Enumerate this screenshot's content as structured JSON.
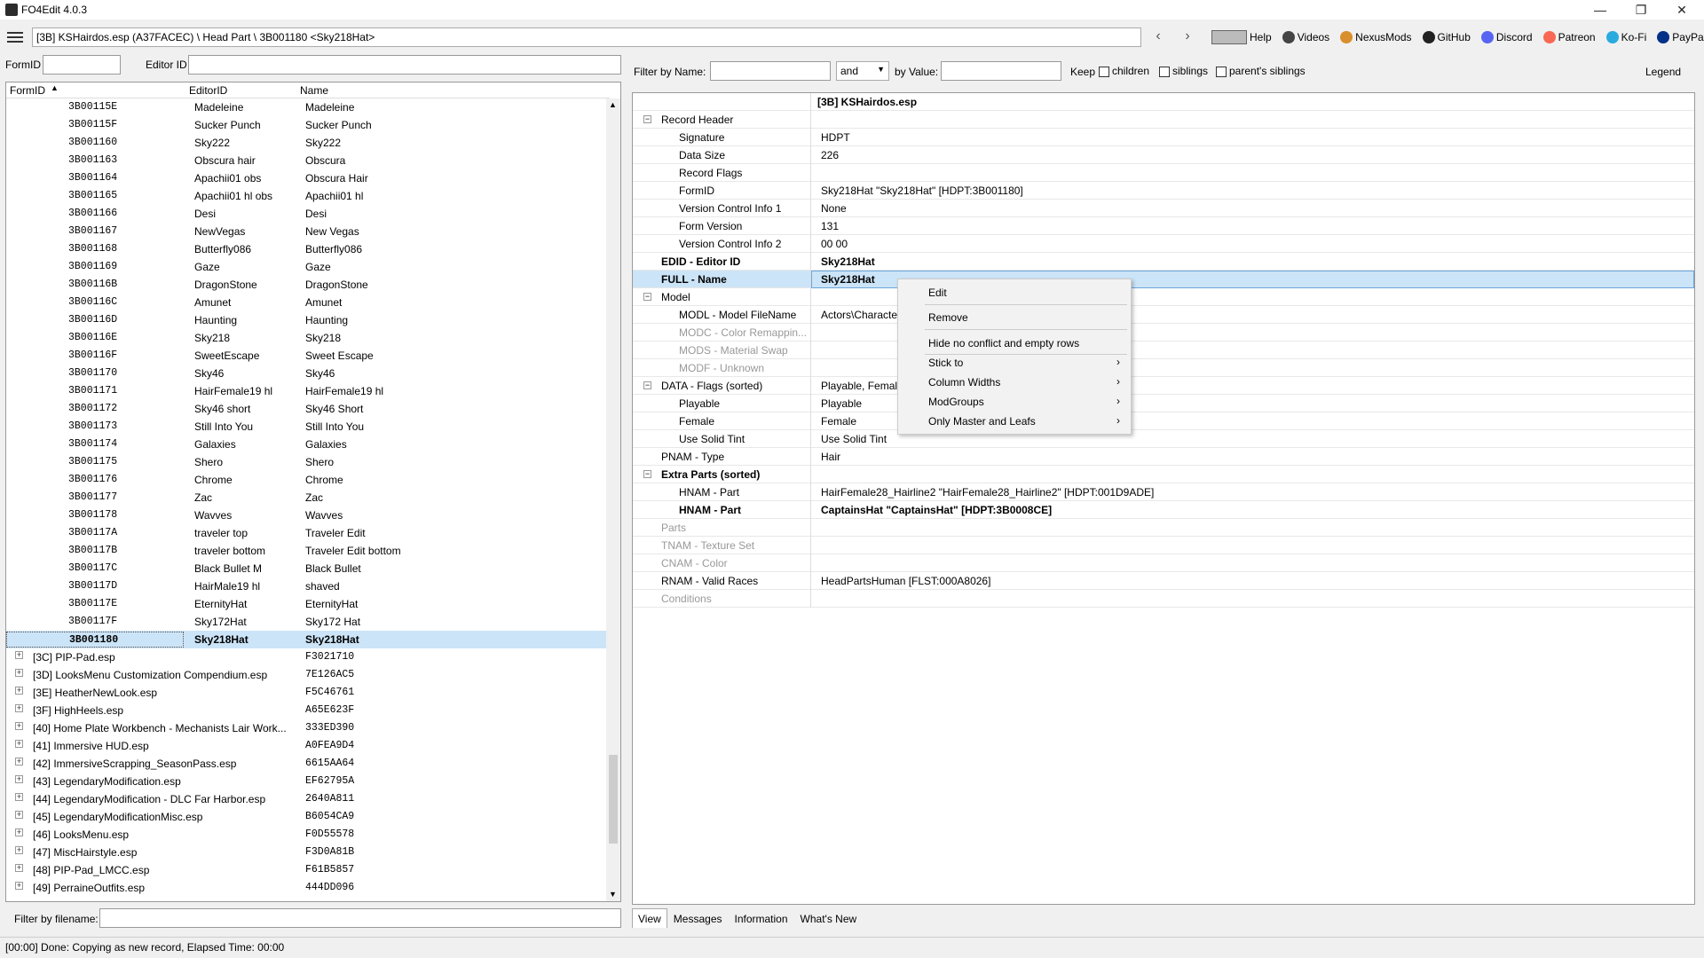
{
  "window": {
    "title": "FO4Edit 4.0.3"
  },
  "toolbar": {
    "path": "[3B] KSHairdos.esp (A37FACEC) \\ Head Part \\ 3B001180 <Sky218Hat>",
    "back": "‹",
    "forward": "›",
    "links": [
      "Help",
      "Videos",
      "NexusMods",
      "GitHub",
      "Discord",
      "Patreon",
      "Ko-Fi",
      "PayPal"
    ]
  },
  "left": {
    "formid_label": "FormID",
    "editorid_label": "Editor ID",
    "columns": [
      "FormID",
      "EditorID",
      "Name"
    ],
    "records": [
      [
        "3B00115E",
        "Madeleine",
        "Madeleine"
      ],
      [
        "3B00115F",
        "Sucker Punch",
        "Sucker Punch"
      ],
      [
        "3B001160",
        "Sky222",
        "Sky222"
      ],
      [
        "3B001163",
        "Obscura hair",
        "Obscura"
      ],
      [
        "3B001164",
        "Apachii01 obs",
        "Obscura Hair"
      ],
      [
        "3B001165",
        "Apachii01 hl obs",
        "Apachii01 hl"
      ],
      [
        "3B001166",
        "Desi",
        "Desi"
      ],
      [
        "3B001167",
        "NewVegas",
        "New Vegas"
      ],
      [
        "3B001168",
        "Butterfly086",
        "Butterfly086"
      ],
      [
        "3B001169",
        "Gaze",
        "Gaze"
      ],
      [
        "3B00116B",
        "DragonStone",
        "DragonStone"
      ],
      [
        "3B00116C",
        "Amunet",
        "Amunet"
      ],
      [
        "3B00116D",
        "Haunting",
        "Haunting"
      ],
      [
        "3B00116E",
        "Sky218",
        "Sky218"
      ],
      [
        "3B00116F",
        "SweetEscape",
        "Sweet Escape"
      ],
      [
        "3B001170",
        "Sky46",
        "Sky46"
      ],
      [
        "3B001171",
        "HairFemale19 hl",
        "HairFemale19 hl"
      ],
      [
        "3B001172",
        "Sky46 short",
        "Sky46 Short"
      ],
      [
        "3B001173",
        "Still Into You",
        "Still Into You"
      ],
      [
        "3B001174",
        "Galaxies",
        "Galaxies"
      ],
      [
        "3B001175",
        "Shero",
        "Shero"
      ],
      [
        "3B001176",
        "Chrome",
        "Chrome"
      ],
      [
        "3B001177",
        "Zac",
        "Zac"
      ],
      [
        "3B001178",
        "Wavves",
        "Wavves"
      ],
      [
        "3B00117A",
        "traveler top",
        "Traveler Edit"
      ],
      [
        "3B00117B",
        "traveler bottom",
        "Traveler Edit bottom"
      ],
      [
        "3B00117C",
        "Black Bullet M",
        "Black Bullet"
      ],
      [
        "3B00117D",
        "HairMale19 hl",
        "shaved"
      ],
      [
        "3B00117E",
        "EternityHat",
        "EternityHat"
      ],
      [
        "3B00117F",
        "Sky172Hat",
        "Sky172 Hat"
      ],
      [
        "3B001180",
        "Sky218Hat",
        "Sky218Hat"
      ]
    ],
    "plugins": [
      [
        "[3C] PIP-Pad.esp",
        "F3021710"
      ],
      [
        "[3D] LooksMenu Customization Compendium.esp",
        "7E126AC5"
      ],
      [
        "[3E] HeatherNewLook.esp",
        "F5C46761"
      ],
      [
        "[3F] HighHeels.esp",
        "A65E623F"
      ],
      [
        "[40] Home Plate Workbench - Mechanists Lair Work...",
        "333ED390"
      ],
      [
        "[41] Immersive HUD.esp",
        "A0FEA9D4"
      ],
      [
        "[42] ImmersiveScrapping_SeasonPass.esp",
        "6615AA64"
      ],
      [
        "[43] LegendaryModification.esp",
        "EF62795A"
      ],
      [
        "[44] LegendaryModification - DLC Far Harbor.esp",
        "2640A811"
      ],
      [
        "[45] LegendaryModificationMisc.esp",
        "B6054CA9"
      ],
      [
        "[46] LooksMenu.esp",
        "F0D55578"
      ],
      [
        "[47] MiscHairstyle.esp",
        "F3D0A81B"
      ],
      [
        "[48] PIP-Pad_LMCC.esp",
        "F61B5857"
      ],
      [
        "[49] PerraineOutfits.esp",
        "444DD096"
      ]
    ],
    "filter_label": "Filter by filename:"
  },
  "right": {
    "filter_name_label": "Filter by Name:",
    "op": "and",
    "by_value_label": "by Value:",
    "keep_label": "Keep",
    "children": "children",
    "siblings": "siblings",
    "parents": "parent's siblings",
    "legend": "Legend",
    "file_header": "[3B] KSHairdos.esp",
    "rows": [
      {
        "k": "Record Header",
        "v": "",
        "lvl": 1,
        "exp": true
      },
      {
        "k": "Signature",
        "v": "HDPT",
        "lvl": 2
      },
      {
        "k": "Data Size",
        "v": "226",
        "lvl": 2
      },
      {
        "k": "Record Flags",
        "v": "",
        "lvl": 2
      },
      {
        "k": "FormID",
        "v": "Sky218Hat \"Sky218Hat\" [HDPT:3B001180]",
        "lvl": 2
      },
      {
        "k": "Version Control Info 1",
        "v": "None",
        "lvl": 2
      },
      {
        "k": "Form Version",
        "v": "131",
        "lvl": 2
      },
      {
        "k": "Version Control Info 2",
        "v": "00 00",
        "lvl": 2
      },
      {
        "k": "EDID - Editor ID",
        "v": "Sky218Hat",
        "lvl": 1,
        "bold": true
      },
      {
        "k": "FULL - Name",
        "v": "Sky218Hat",
        "lvl": 1,
        "bold": true,
        "hl": true
      },
      {
        "k": "Model",
        "v": "",
        "lvl": 1,
        "exp": true
      },
      {
        "k": "MODL - Model FileName",
        "v": "Actors\\Characte",
        "lvl": 2
      },
      {
        "k": "MODC - Color Remappin...",
        "v": "",
        "lvl": 2,
        "dim": true
      },
      {
        "k": "MODS - Material Swap",
        "v": "",
        "lvl": 2,
        "dim": true
      },
      {
        "k": "MODF - Unknown",
        "v": "",
        "lvl": 2,
        "dim": true
      },
      {
        "k": "DATA - Flags (sorted)",
        "v": "Playable, Female",
        "lvl": 1,
        "exp": true
      },
      {
        "k": "Playable",
        "v": "Playable",
        "lvl": 2
      },
      {
        "k": "Female",
        "v": "Female",
        "lvl": 2
      },
      {
        "k": "Use Solid Tint",
        "v": "Use Solid Tint",
        "lvl": 2
      },
      {
        "k": "PNAM - Type",
        "v": "Hair",
        "lvl": 1
      },
      {
        "k": "Extra Parts (sorted)",
        "v": "",
        "lvl": 1,
        "exp": true,
        "bold": true
      },
      {
        "k": "HNAM - Part",
        "v": "HairFemale28_Hairline2 \"HairFemale28_Hairline2\" [HDPT:001D9ADE]",
        "lvl": 2
      },
      {
        "k": "HNAM - Part",
        "v": "CaptainsHat \"CaptainsHat\" [HDPT:3B0008CE]",
        "lvl": 2,
        "bold": true
      },
      {
        "k": "Parts",
        "v": "",
        "lvl": 1,
        "dim": true
      },
      {
        "k": "TNAM - Texture Set",
        "v": "",
        "lvl": 1,
        "dim": true
      },
      {
        "k": "CNAM - Color",
        "v": "",
        "lvl": 1,
        "dim": true
      },
      {
        "k": "RNAM - Valid Races",
        "v": "HeadPartsHuman [FLST:000A8026]",
        "lvl": 1
      },
      {
        "k": "Conditions",
        "v": "",
        "lvl": 1,
        "dim": true
      }
    ],
    "tabs": [
      "View",
      "Messages",
      "Information",
      "What's New"
    ]
  },
  "context_menu": {
    "items": [
      {
        "label": "Edit"
      },
      {
        "label": "Remove"
      },
      {
        "label": "Hide no conflict and empty rows"
      },
      {
        "label": "Stick to",
        "sub": true
      },
      {
        "label": "Column Widths",
        "sub": true
      },
      {
        "label": "ModGroups",
        "sub": true
      },
      {
        "label": "Only Master and Leafs",
        "sub": true
      }
    ]
  },
  "status": {
    "text": "[00:00] Done: Copying as new record, Elapsed Time: 00:00"
  },
  "colors": {
    "selection": "#cce4f7"
  }
}
